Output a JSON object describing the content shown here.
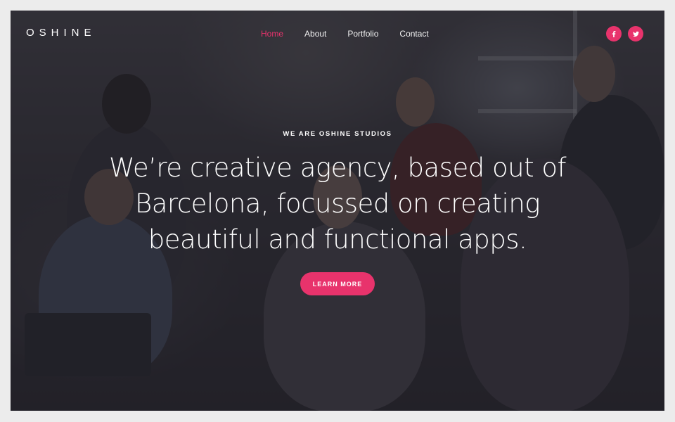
{
  "header": {
    "logo": "OSHINE",
    "nav": [
      {
        "label": "Home",
        "active": true
      },
      {
        "label": "About",
        "active": false
      },
      {
        "label": "Portfolio",
        "active": false
      },
      {
        "label": "Contact",
        "active": false
      }
    ],
    "social": [
      {
        "icon": "facebook-icon",
        "glyph": "f"
      },
      {
        "icon": "twitter-icon",
        "glyph": "t"
      }
    ]
  },
  "hero": {
    "eyebrow": "WE ARE OSHINE STUDIOS",
    "headline": "We’re creative agency, based out of Barcelona, focussed on creating beautiful and functional apps.",
    "cta_label": "LEARN MORE"
  },
  "colors": {
    "accent": "#e8336c",
    "overlay": "#1e1c24",
    "page_border": "#ececec"
  }
}
